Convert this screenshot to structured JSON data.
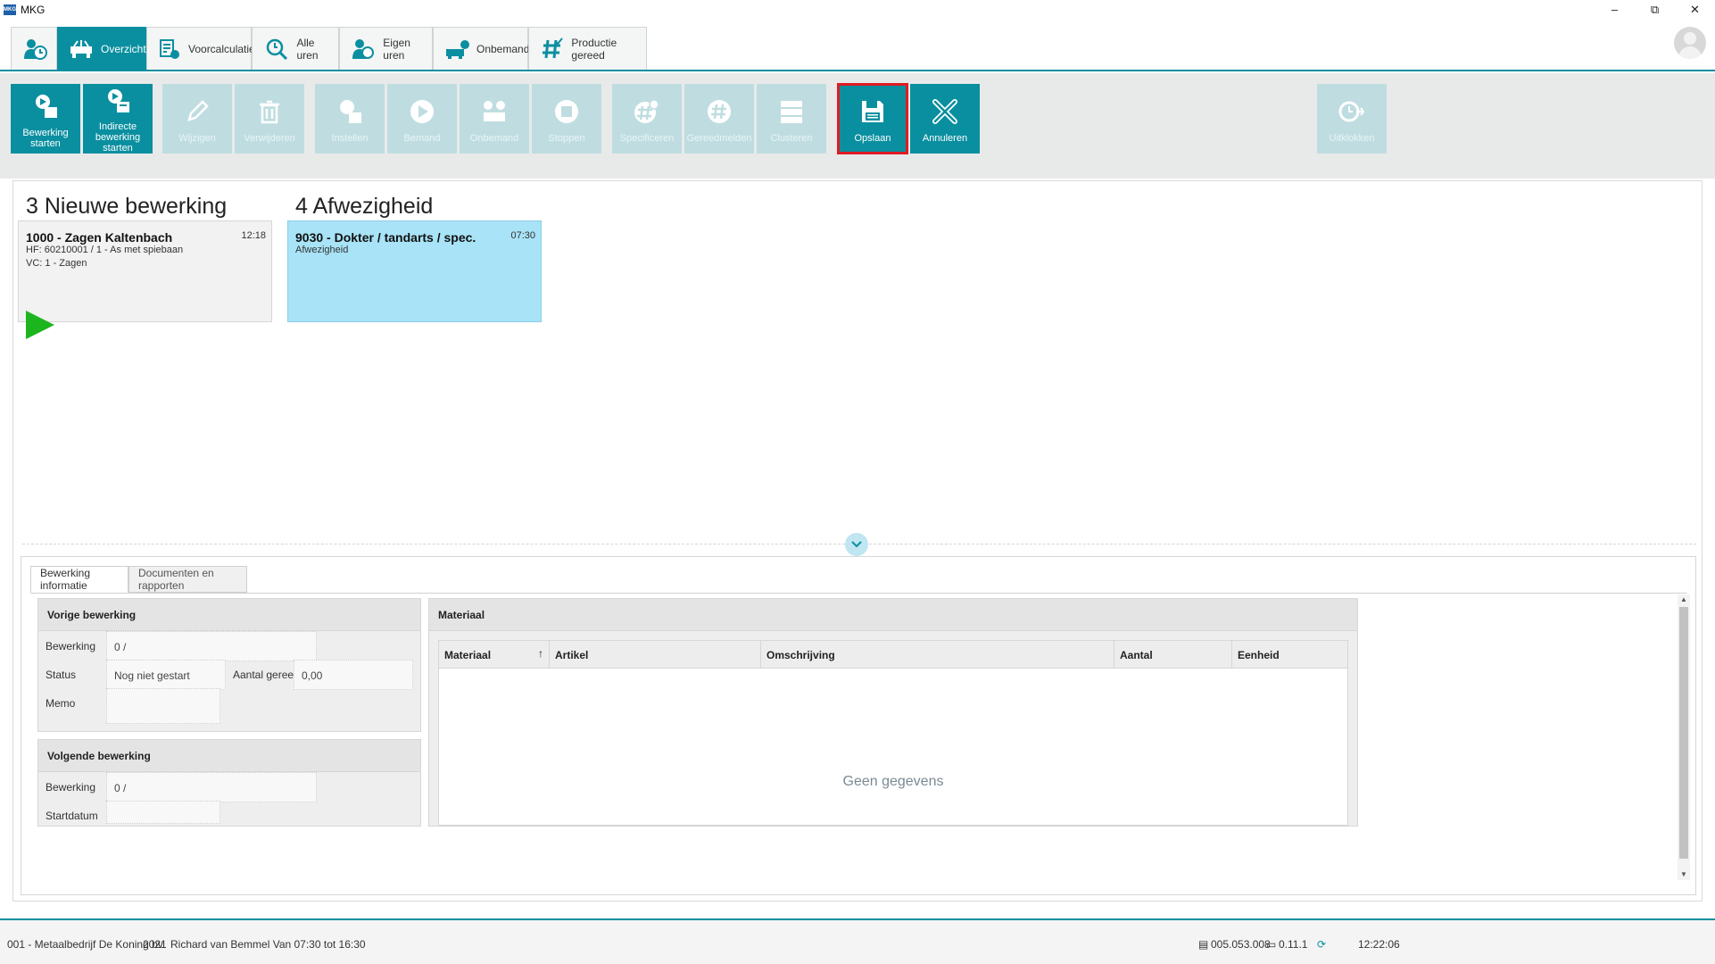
{
  "window": {
    "title": "MKG",
    "logo_text": "MKG"
  },
  "tabs": [
    {
      "label": "",
      "icon": "clock-person-icon"
    },
    {
      "label": "Overzicht",
      "icon": "machine-icon"
    },
    {
      "label": "Voorcalculatie",
      "icon": "calculator-icon"
    },
    {
      "label": "Alle uren",
      "icon": "search-hours-icon"
    },
    {
      "label": "Eigen uren",
      "icon": "person-clock-icon"
    },
    {
      "label": "Onbemand",
      "icon": "machine-unmanned-icon"
    },
    {
      "label": "Productie gereed",
      "icon": "hash-check-icon"
    }
  ],
  "ribbon": {
    "bewerking_starten": "Bewerking starten",
    "indirecte_bewerking_line1": "Indirecte",
    "indirecte_bewerking_line2": "bewerking starten",
    "wijzigen": "Wijzigen",
    "verwijderen": "Verwijderen",
    "instellen": "Instellen",
    "bemand": "Bemand",
    "onbemand": "Onbemand",
    "stoppen": "Stoppen",
    "specificeren": "Specificeren",
    "gereedmelden": "Gereedmelden",
    "clusteren": "Clusteren",
    "opslaan": "Opslaan",
    "annuleren": "Annuleren",
    "uitklokken": "Uitklokken"
  },
  "groups": [
    {
      "title": "3 Nieuwe bewerking",
      "card": {
        "title": "1000 - Zagen Kaltenbach",
        "time": "12:18",
        "line1": "HF: 60210001 / 1 - As met spiebaan",
        "line2": "VC: 1 - Zagen"
      }
    },
    {
      "title": "4 Afwezigheid",
      "card": {
        "title": "9030 - Dokter / tandarts / spec.",
        "time": "07:30",
        "line1": "Afwezigheid"
      }
    }
  ],
  "detail": {
    "tabs": [
      "Bewerking informatie",
      "Documenten en rapporten"
    ],
    "vorige": {
      "title": "Vorige bewerking",
      "bewerking_label": "Bewerking",
      "bewerking_value": "0 /",
      "status_label": "Status",
      "status_value": "Nog niet gestart",
      "aantal_label": "Aantal gereed",
      "aantal_value": "0,00",
      "memo_label": "Memo",
      "memo_value": ""
    },
    "volgende": {
      "title": "Volgende bewerking",
      "bewerking_label": "Bewerking",
      "bewerking_value": "0 /",
      "startdatum_label": "Startdatum",
      "startdatum_value": ""
    },
    "materiaal": {
      "title": "Materiaal",
      "columns": [
        "Materiaal",
        "Artikel",
        "Omschrijving",
        "Aantal",
        "Eenheid"
      ],
      "sort_indicator": "↑",
      "empty_text": "Geen gegevens"
    }
  },
  "status": {
    "company": "001 - Metaalbedrijf De Koning bv",
    "year": "2021",
    "user_schedule": "Richard van Bemmel Van 07:30 tot 16:30",
    "db_version": "005.053.008",
    "client_version": "0.11.1",
    "time": "12:22:06"
  },
  "colors": {
    "accent": "#0a8fa0",
    "highlight": "#e11b22",
    "play": "#1db51d",
    "absence_card": "#a8e3f7"
  }
}
